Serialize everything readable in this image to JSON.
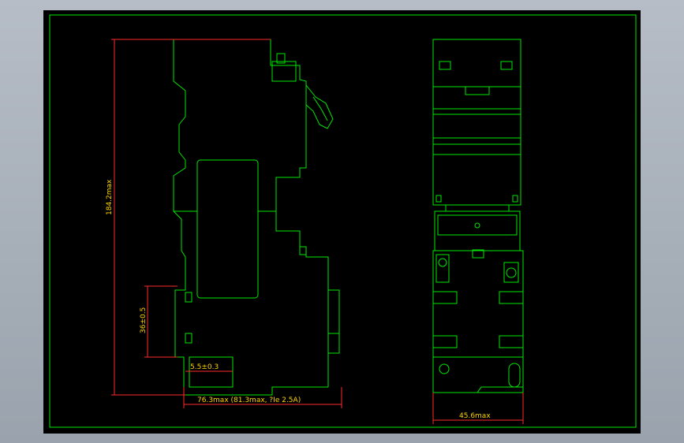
{
  "colors": {
    "background": "#000000",
    "outline": "#00e600",
    "dimension_line": "#ff2a2a",
    "dimension_text": "#ffd400",
    "frame_outer": "#aab1ba"
  },
  "dimensions": {
    "height_total": "184.2max",
    "mount_height": "36±0.5",
    "offset": "5.5±0.3",
    "depth": "76.3max (81.3max, ?Ie 2.5A)",
    "width": "45.6max"
  }
}
